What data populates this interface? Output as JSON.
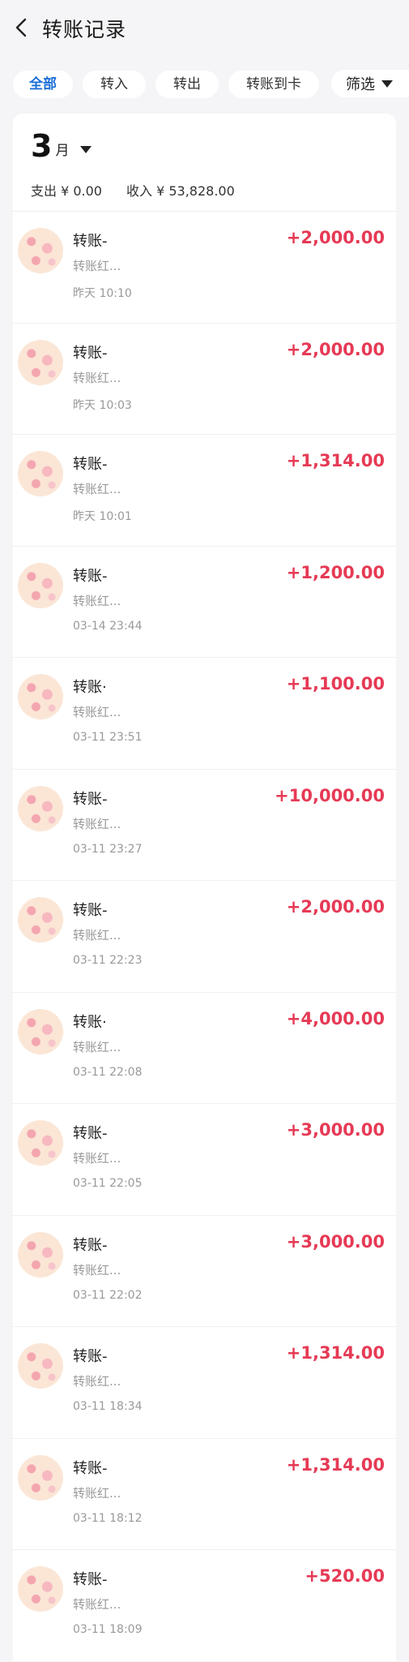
{
  "header": {
    "title": "转账记录"
  },
  "filters": {
    "chips": [
      "全部",
      "转入",
      "转出",
      "转账到卡"
    ],
    "filter_label": "筛选"
  },
  "month": {
    "number": "3",
    "unit": "月",
    "expense": "支出 ¥ 0.00",
    "income": "收入 ¥ 53,828.00"
  },
  "transactions": [
    {
      "name": "转账-",
      "desc": "转账红...",
      "time": "昨天 10:10",
      "amount": "+2,000.00"
    },
    {
      "name": "转账-",
      "desc": "转账红...",
      "time": "昨天 10:03",
      "amount": "+2,000.00"
    },
    {
      "name": "转账-",
      "desc": "转账红...",
      "time": "昨天 10:01",
      "amount": "+1,314.00"
    },
    {
      "name": "转账-",
      "desc": "转账红...",
      "time": "03-14 23:44",
      "amount": "+1,200.00"
    },
    {
      "name": "转账·",
      "desc": "转账红...",
      "time": "03-11 23:51",
      "amount": "+1,100.00"
    },
    {
      "name": "转账-",
      "desc": "转账红...",
      "time": "03-11 23:27",
      "amount": "+10,000.00"
    },
    {
      "name": "转账-",
      "desc": "转账红...",
      "time": "03-11 22:23",
      "amount": "+2,000.00"
    },
    {
      "name": "转账·",
      "desc": "转账红...",
      "time": "03-11 22:08",
      "amount": "+4,000.00"
    },
    {
      "name": "转账-",
      "desc": "转账红...",
      "time": "03-11 22:05",
      "amount": "+3,000.00"
    },
    {
      "name": "转账-",
      "desc": "转账红...",
      "time": "03-11 22:02",
      "amount": "+3,000.00"
    },
    {
      "name": "转账-",
      "desc": "转账红...",
      "time": "03-11 18:34",
      "amount": "+1,314.00"
    },
    {
      "name": "转账-",
      "desc": "转账红...",
      "time": "03-11 18:12",
      "amount": "+1,314.00"
    },
    {
      "name": "转账-",
      "desc": "转账红...",
      "time": "03-11 18:09",
      "amount": "+520.00"
    }
  ]
}
